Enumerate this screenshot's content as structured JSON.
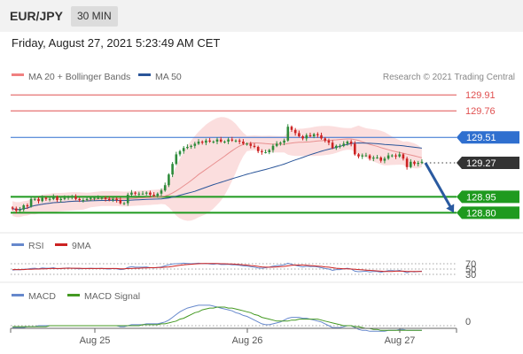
{
  "header": {
    "symbol": "EUR/JPY",
    "interval": "30 MIN",
    "datetime": "Friday, August 27, 2021 5:23:49 AM CET"
  },
  "legend": {
    "bollinger": "MA 20 + Bollinger Bands",
    "ma50": "MA 50",
    "credit": "Research © 2021 Trading Central",
    "rsi": "RSI",
    "rsi_ma": "9MA",
    "macd": "MACD",
    "macd_signal": "MACD Signal"
  },
  "colors": {
    "up_candle": "#2e8b3a",
    "down_candle": "#cc2222",
    "bollinger_band": "#f8c8c8",
    "ma20": "#e89090",
    "ma50": "#2a5599",
    "resistance": "#e05050",
    "support": "#1f9a1f",
    "pivot": "#2f6fcf",
    "last_price": "#333333",
    "forecast_arrow": "#2a5aa0",
    "rsi": "#6688cc",
    "rsi_ma": "#cc2222",
    "macd": "#6688cc",
    "macd_signal": "#449922"
  },
  "chart_data": [
    {
      "type": "candlestick",
      "title": "",
      "x_labels": [
        "Aug 25",
        "Aug 26",
        "Aug 27"
      ],
      "y_range": [
        128.72,
        129.97
      ],
      "close_series": [
        128.84,
        128.82,
        128.83,
        128.87,
        128.86,
        128.93,
        128.93,
        128.91,
        128.94,
        128.93,
        128.93,
        128.95,
        128.92,
        128.93,
        128.94,
        128.95,
        128.95,
        128.93,
        128.92,
        128.92,
        128.93,
        128.94,
        128.94,
        128.94,
        128.94,
        128.93,
        128.92,
        128.93,
        128.92,
        128.89,
        128.89,
        128.97,
        128.99,
        128.98,
        128.98,
        128.98,
        128.99,
        128.97,
        128.96,
        128.98,
        129.01,
        129.06,
        129.16,
        129.26,
        129.35,
        129.38,
        129.41,
        129.42,
        129.43,
        129.45,
        129.47,
        129.46,
        129.48,
        129.47,
        129.47,
        129.49,
        129.47,
        129.47,
        129.49,
        129.48,
        129.48,
        129.47,
        129.45,
        129.45,
        129.43,
        129.42,
        129.38,
        129.37,
        129.37,
        129.39,
        129.43,
        129.45,
        129.46,
        129.48,
        129.61,
        129.58,
        129.55,
        129.52,
        129.5,
        129.53,
        129.52,
        129.54,
        129.53,
        129.5,
        129.48,
        129.46,
        129.41,
        129.43,
        129.43,
        129.45,
        129.47,
        129.45,
        129.35,
        129.33,
        129.34,
        129.34,
        129.31,
        129.32,
        129.32,
        129.29,
        129.31,
        129.34,
        129.34,
        129.33,
        129.35,
        129.31,
        129.23,
        129.28,
        129.26,
        129.27,
        129.28
      ],
      "bollinger": {
        "ma_period": 20,
        "bands": "upper/lower envelope"
      },
      "ma_period_long": 50,
      "levels": [
        {
          "value": 129.91,
          "label": "129.91",
          "kind": "resistance"
        },
        {
          "value": 129.76,
          "label": "129.76",
          "kind": "resistance"
        },
        {
          "value": 129.51,
          "label": "129.51",
          "kind": "pivot"
        },
        {
          "value": 129.27,
          "label": "129.27",
          "kind": "last"
        },
        {
          "value": 128.95,
          "label": "128.95",
          "kind": "support"
        },
        {
          "value": 128.8,
          "label": "128.80",
          "kind": "support"
        }
      ],
      "forecast": {
        "from": 129.27,
        "to": 128.8,
        "direction": "down"
      }
    },
    {
      "type": "line",
      "name": "RSI",
      "y_ticks": [
        "70",
        "50",
        "30"
      ],
      "levels": [
        70,
        50,
        30
      ],
      "series": [
        {
          "name": "RSI",
          "values": [
            46,
            48,
            47,
            49,
            50,
            52,
            53,
            51,
            54,
            53,
            53,
            55,
            51,
            52,
            53,
            54,
            53,
            52,
            51,
            52,
            52,
            53,
            52,
            52,
            53,
            51,
            50,
            52,
            51,
            48,
            49,
            56,
            59,
            57,
            57,
            57,
            58,
            55,
            54,
            56,
            58,
            62,
            66,
            69,
            70,
            71,
            72,
            71,
            70,
            71,
            72,
            70,
            71,
            69,
            68,
            70,
            67,
            67,
            68,
            66,
            66,
            64,
            62,
            61,
            59,
            57,
            54,
            53,
            55,
            57,
            61,
            63,
            64,
            66,
            72,
            68,
            64,
            61,
            58,
            61,
            59,
            60,
            58,
            55,
            52,
            50,
            45,
            48,
            48,
            51,
            53,
            50,
            42,
            40,
            41,
            42,
            39,
            41,
            41,
            38,
            41,
            44,
            44,
            43,
            45,
            41,
            36,
            41,
            39,
            41,
            42
          ]
        },
        {
          "name": "9MA",
          "values": [
            48,
            48,
            48,
            48,
            49,
            49,
            50,
            50,
            51,
            51,
            52,
            52,
            52,
            52,
            53,
            53,
            53,
            53,
            53,
            52,
            52,
            52,
            52,
            52,
            52,
            52,
            52,
            52,
            52,
            51,
            51,
            52,
            52,
            53,
            53,
            54,
            54,
            55,
            55,
            56,
            56,
            57,
            58,
            60,
            62,
            64,
            66,
            67,
            68,
            69,
            70,
            71,
            71,
            71,
            71,
            71,
            70,
            70,
            69,
            69,
            68,
            67,
            66,
            65,
            63,
            62,
            60,
            58,
            57,
            57,
            57,
            58,
            59,
            60,
            62,
            64,
            65,
            65,
            65,
            64,
            63,
            62,
            61,
            60,
            58,
            57,
            55,
            53,
            52,
            51,
            51,
            50,
            49,
            48,
            47,
            46,
            45,
            44,
            43,
            42,
            41,
            41,
            41,
            42,
            42,
            42,
            41,
            41,
            41,
            41,
            41
          ]
        }
      ]
    },
    {
      "type": "line",
      "name": "MACD",
      "y_ticks": [
        "0"
      ],
      "zero_line": 0,
      "series": [
        {
          "name": "MACD",
          "values": [
            -0.02,
            -0.02,
            -0.02,
            -0.02,
            -0.01,
            -0.01,
            -0.01,
            0,
            0,
            0,
            0,
            0,
            0,
            0,
            0,
            0,
            0,
            0,
            0,
            0,
            0,
            0,
            0,
            0,
            0,
            0,
            0,
            0,
            0,
            -0.01,
            -0.01,
            0,
            0.01,
            0.01,
            0.01,
            0.01,
            0.02,
            0.02,
            0.02,
            0.02,
            0.03,
            0.04,
            0.06,
            0.09,
            0.12,
            0.15,
            0.17,
            0.19,
            0.2,
            0.21,
            0.22,
            0.22,
            0.22,
            0.22,
            0.21,
            0.2,
            0.19,
            0.18,
            0.17,
            0.16,
            0.14,
            0.13,
            0.11,
            0.1,
            0.08,
            0.06,
            0.04,
            0.02,
            0.01,
            0.01,
            0.02,
            0.03,
            0.04,
            0.06,
            0.08,
            0.09,
            0.09,
            0.09,
            0.08,
            0.08,
            0.07,
            0.06,
            0.05,
            0.04,
            0.02,
            0,
            -0.02,
            -0.02,
            -0.02,
            -0.01,
            0,
            0,
            -0.02,
            -0.04,
            -0.05,
            -0.05,
            -0.06,
            -0.06,
            -0.06,
            -0.06,
            -0.06,
            -0.05,
            -0.05,
            -0.05,
            -0.04,
            -0.04,
            -0.05,
            -0.05,
            -0.05,
            -0.05,
            -0.05
          ]
        },
        {
          "name": "MACD Signal",
          "values": [
            -0.01,
            -0.01,
            -0.01,
            -0.01,
            -0.01,
            -0.01,
            -0.01,
            -0.01,
            -0.01,
            -0.01,
            0,
            0,
            0,
            0,
            0,
            0,
            0,
            0,
            0,
            0,
            0,
            0,
            0,
            0,
            0,
            0,
            0,
            0,
            0,
            0,
            0,
            0,
            0,
            0,
            0,
            0.01,
            0.01,
            0.01,
            0.01,
            0.01,
            0.02,
            0.02,
            0.03,
            0.04,
            0.05,
            0.07,
            0.08,
            0.1,
            0.12,
            0.14,
            0.15,
            0.17,
            0.18,
            0.19,
            0.19,
            0.2,
            0.2,
            0.2,
            0.19,
            0.19,
            0.18,
            0.17,
            0.16,
            0.15,
            0.14,
            0.12,
            0.11,
            0.09,
            0.08,
            0.07,
            0.06,
            0.05,
            0.05,
            0.05,
            0.05,
            0.06,
            0.06,
            0.07,
            0.07,
            0.07,
            0.07,
            0.07,
            0.07,
            0.06,
            0.05,
            0.04,
            0.03,
            0.02,
            0.01,
            0,
            0,
            0,
            -0.01,
            -0.01,
            -0.02,
            -0.03,
            -0.03,
            -0.04,
            -0.04,
            -0.05,
            -0.05,
            -0.05,
            -0.05,
            -0.05,
            -0.05,
            -0.05,
            -0.05,
            -0.05,
            -0.05,
            -0.05,
            -0.05
          ]
        }
      ]
    }
  ]
}
